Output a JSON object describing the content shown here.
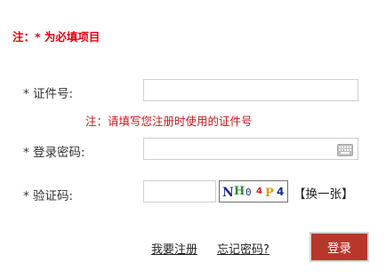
{
  "form": {
    "required_note": "注：* 为必填项目",
    "id_label": "* 证件号:",
    "id_value": "",
    "id_hint": "注：请填写您注册时使用的证件号",
    "password_label": "* 登录密码:",
    "password_value": "",
    "password_icon": "keyboard-icon",
    "captcha_label": "* 验证码:",
    "captcha_value": "",
    "captcha_image": {
      "chars": [
        {
          "ch": "N",
          "color": "#1a2f8a"
        },
        {
          "ch": "H",
          "color": "#2e8b2e"
        },
        {
          "ch": "0",
          "color": "#1a2f8a"
        },
        {
          "ch": "4",
          "color": "#c81e1e"
        },
        {
          "ch": "P",
          "color": "#d4a017"
        },
        {
          "ch": "4",
          "color": "#1a2f8a"
        }
      ]
    },
    "captcha_refresh": "【换一张】"
  },
  "actions": {
    "register_link": "我要注册",
    "forgot_link": "忘记密码?",
    "login_button": "登录"
  },
  "colors": {
    "note_red": "#e60012",
    "hint_red": "#c8161d",
    "button_bg": "#b8372a",
    "input_border": "#cfcfcf"
  }
}
